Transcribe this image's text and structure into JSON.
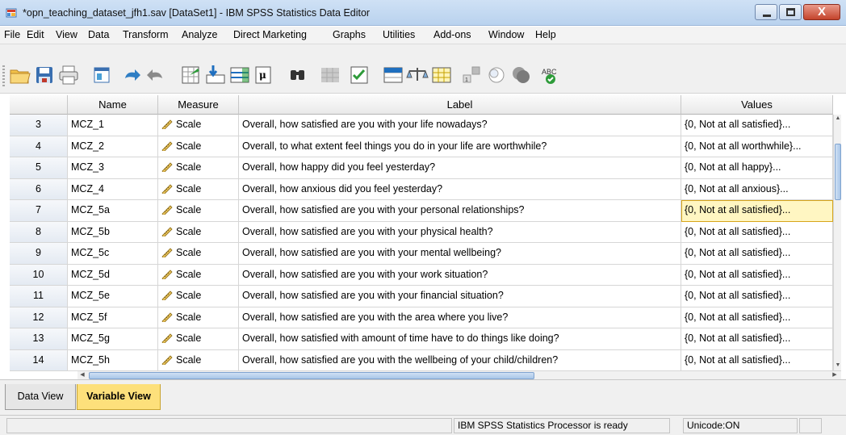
{
  "window": {
    "title": "*opn_teaching_dataset_jfh1.sav [DataSet1] - IBM SPSS Statistics Data Editor",
    "close_glyph": "X"
  },
  "menu": [
    "File",
    "Edit",
    "View",
    "Data",
    "Transform",
    "Analyze",
    "Direct Marketing",
    "Graphs",
    "Utilities",
    "Add-ons",
    "Window",
    "Help"
  ],
  "toolbar": {
    "icons": [
      "open-folder-icon",
      "save-icon",
      "print-icon",
      "dialog-recall-icon",
      "undo-icon",
      "redo-icon",
      "goto-case-icon",
      "goto-variable-icon",
      "variables-icon",
      "run-descriptives-icon",
      "find-icon",
      "insert-cases-icon",
      "insert-variable-icon",
      "split-file-icon",
      "weight-cases-icon",
      "select-cases-icon",
      "value-labels-icon",
      "use-variable-sets-icon",
      "show-all-variables-icon",
      "spell-check-icon"
    ],
    "spell_label": "ABC"
  },
  "grid": {
    "columns": [
      "",
      "Name",
      "Measure",
      "Label",
      "Values"
    ],
    "rows": [
      {
        "num": "3",
        "name": "MCZ_1",
        "measure": "Scale",
        "label": "Overall, how satisfied are you with your life nowadays?",
        "values": "{0, Not at all satisfied}..."
      },
      {
        "num": "4",
        "name": "MCZ_2",
        "measure": "Scale",
        "label": "Overall, to what extent feel things you do in your life are worthwhile?",
        "values": "{0, Not at all worthwhile}..."
      },
      {
        "num": "5",
        "name": "MCZ_3",
        "measure": "Scale",
        "label": "Overall, how happy did you feel yesterday?",
        "values": "{0, Not at all happy}..."
      },
      {
        "num": "6",
        "name": "MCZ_4",
        "measure": "Scale",
        "label": "Overall, how anxious did you feel yesterday?",
        "values": "{0, Not at all anxious}..."
      },
      {
        "num": "7",
        "name": "MCZ_5a",
        "measure": "Scale",
        "label": "Overall, how satisfied are you with your personal relationships?",
        "values": "{0, Not at all satisfied}..."
      },
      {
        "num": "8",
        "name": "MCZ_5b",
        "measure": "Scale",
        "label": "Overall, how satisfied are you with your physical health?",
        "values": "{0, Not at all satisfied}..."
      },
      {
        "num": "9",
        "name": "MCZ_5c",
        "measure": "Scale",
        "label": "Overall, how satisfied are you with your mental wellbeing?",
        "values": "{0, Not at all satisfied}..."
      },
      {
        "num": "10",
        "name": "MCZ_5d",
        "measure": "Scale",
        "label": "Overall, how satisfied are you with your work situation?",
        "values": "{0, Not at all satisfied}..."
      },
      {
        "num": "11",
        "name": "MCZ_5e",
        "measure": "Scale",
        "label": "Overall, how satisfied are you with your financial situation?",
        "values": "{0, Not at all satisfied}..."
      },
      {
        "num": "12",
        "name": "MCZ_5f",
        "measure": "Scale",
        "label": "Overall, how satisfied are you with the area where you live?",
        "values": "{0, Not at all satisfied}..."
      },
      {
        "num": "13",
        "name": "MCZ_5g",
        "measure": "Scale",
        "label": "Overall, how satisfied with amount of time have to do things like doing?",
        "values": "{0, Not at all satisfied}..."
      },
      {
        "num": "14",
        "name": "MCZ_5h",
        "measure": "Scale",
        "label": "Overall, how satisfied are you with the wellbeing of your child/children?",
        "values": "{0, Not at all satisfied}..."
      }
    ],
    "selected_row_index": 4,
    "measure_icon": "ruler-icon"
  },
  "tabs": {
    "data_view": "Data View",
    "variable_view": "Variable View",
    "active": "variable_view"
  },
  "status": {
    "processor": "IBM SPSS Statistics Processor is ready",
    "unicode": "Unicode:ON"
  },
  "colors": {
    "selected_cell": "#fff6c2",
    "active_tab": "#fde07b",
    "titlebar": "#c4d9f1"
  }
}
